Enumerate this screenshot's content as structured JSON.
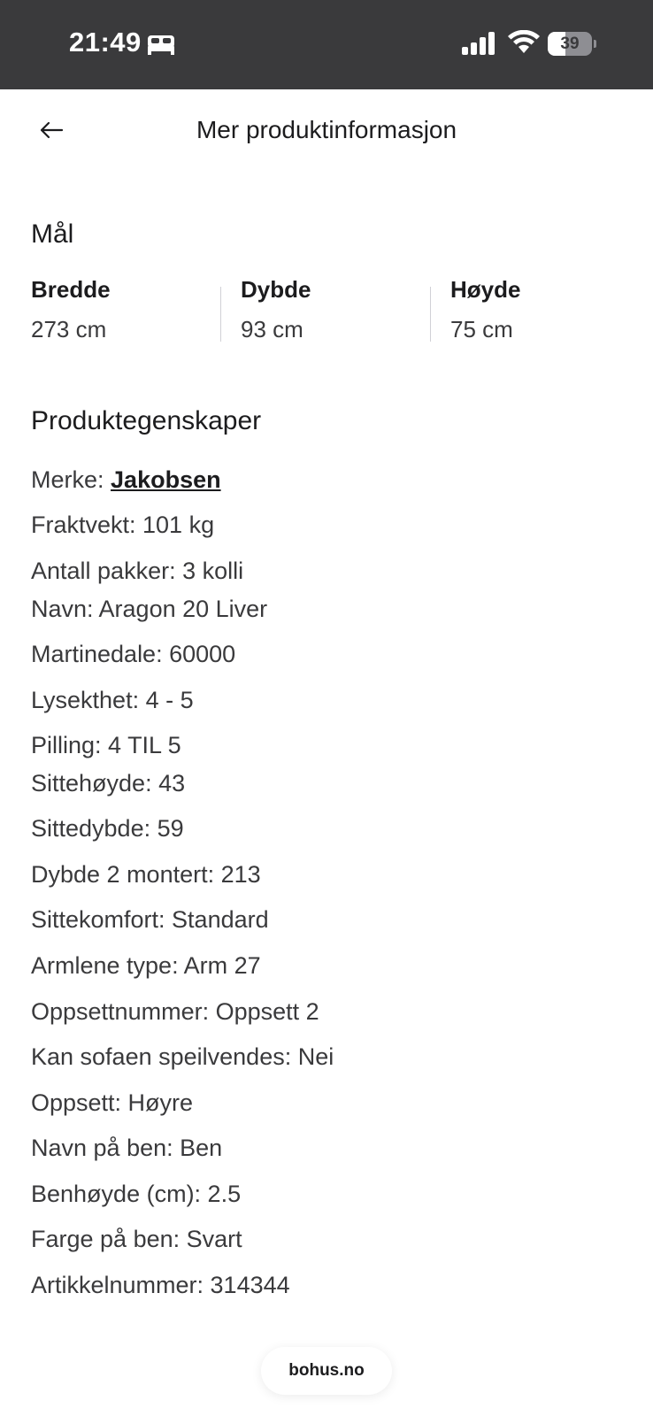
{
  "status_bar": {
    "time": "21:49",
    "focus_icon": "bed-icon",
    "battery_level": "39",
    "battery_fraction": 0.39
  },
  "header": {
    "back_icon": "arrow-left-icon",
    "title": "Mer produktinformasjon"
  },
  "dimensions": {
    "title": "Mål",
    "items": [
      {
        "label": "Bredde",
        "value": "273 cm"
      },
      {
        "label": "Dybde",
        "value": "93 cm"
      },
      {
        "label": "Høyde",
        "value": "75 cm"
      }
    ]
  },
  "properties": {
    "title": "Produktegenskaper",
    "brand_label": "Merke: ",
    "brand_value": "Jakobsen",
    "items": [
      "Fraktvekt: 101 kg",
      "Antall pakker: 3 kolli",
      "Navn: Aragon 20 Liver",
      "Martinedale: 60000",
      "Lysekthet: 4 - 5",
      "Pilling: 4 TIL 5",
      "Sittehøyde: 43",
      "Sittedybde: 59",
      "Dybde 2 montert: 213",
      "Sittekomfort: Standard",
      "Armlene type: Arm 27",
      "Oppsettnummer: Oppsett 2",
      "Kan sofaen speilvendes: Nei",
      "Oppsett: Høyre",
      "Navn på ben: Ben",
      "Benhøyde (cm): 2.5",
      "Farge på ben: Svart",
      "Artikkelnummer: 314344"
    ]
  },
  "footer": {
    "domain": "bohus.no"
  }
}
